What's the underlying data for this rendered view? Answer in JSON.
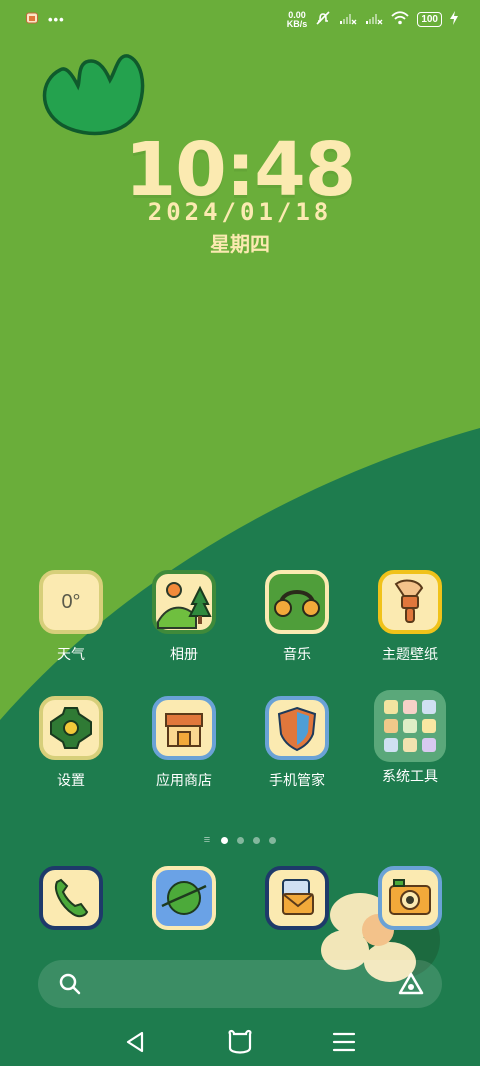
{
  "status_bar": {
    "notification_icon": "shop-app-icon",
    "more_icon": "more-dots-icon",
    "net_speed_value": "0.00",
    "net_speed_unit": "KB/s",
    "battery": "100",
    "icons": [
      "mute-icon",
      "signal-1-icon",
      "signal-2-icon",
      "wifi-icon",
      "battery-icon",
      "charging-icon"
    ]
  },
  "clock": {
    "time": "10:48",
    "date": "2024/01/18",
    "weekday": "星期四"
  },
  "apps": {
    "row1": [
      {
        "label": "天气",
        "value": "0°",
        "icon": "weather-icon"
      },
      {
        "label": "相册",
        "icon": "gallery-icon"
      },
      {
        "label": "音乐",
        "icon": "music-icon"
      },
      {
        "label": "主题壁纸",
        "icon": "theme-icon"
      }
    ],
    "row2": [
      {
        "label": "设置",
        "icon": "settings-icon"
      },
      {
        "label": "应用商店",
        "icon": "app-store-icon"
      },
      {
        "label": "手机管家",
        "icon": "phone-manager-icon"
      },
      {
        "label": "系统工具",
        "icon": "system-tools-folder-icon"
      }
    ]
  },
  "dock": [
    {
      "name": "phone",
      "icon": "phone-icon"
    },
    {
      "name": "browser",
      "icon": "browser-icon"
    },
    {
      "name": "messages",
      "icon": "messages-icon"
    },
    {
      "name": "camera",
      "icon": "camera-icon"
    }
  ],
  "page_indicator": {
    "pages": 4,
    "active": 0
  },
  "search_bar": {
    "left_icon": "search-icon",
    "right_icon": "assistant-icon"
  },
  "nav": [
    "back-icon",
    "home-icon",
    "menu-icon"
  ],
  "colors": {
    "top_green": "#6aae3a",
    "bottom_green": "#1e7c4e",
    "clock_cream": "#fbeab1"
  }
}
